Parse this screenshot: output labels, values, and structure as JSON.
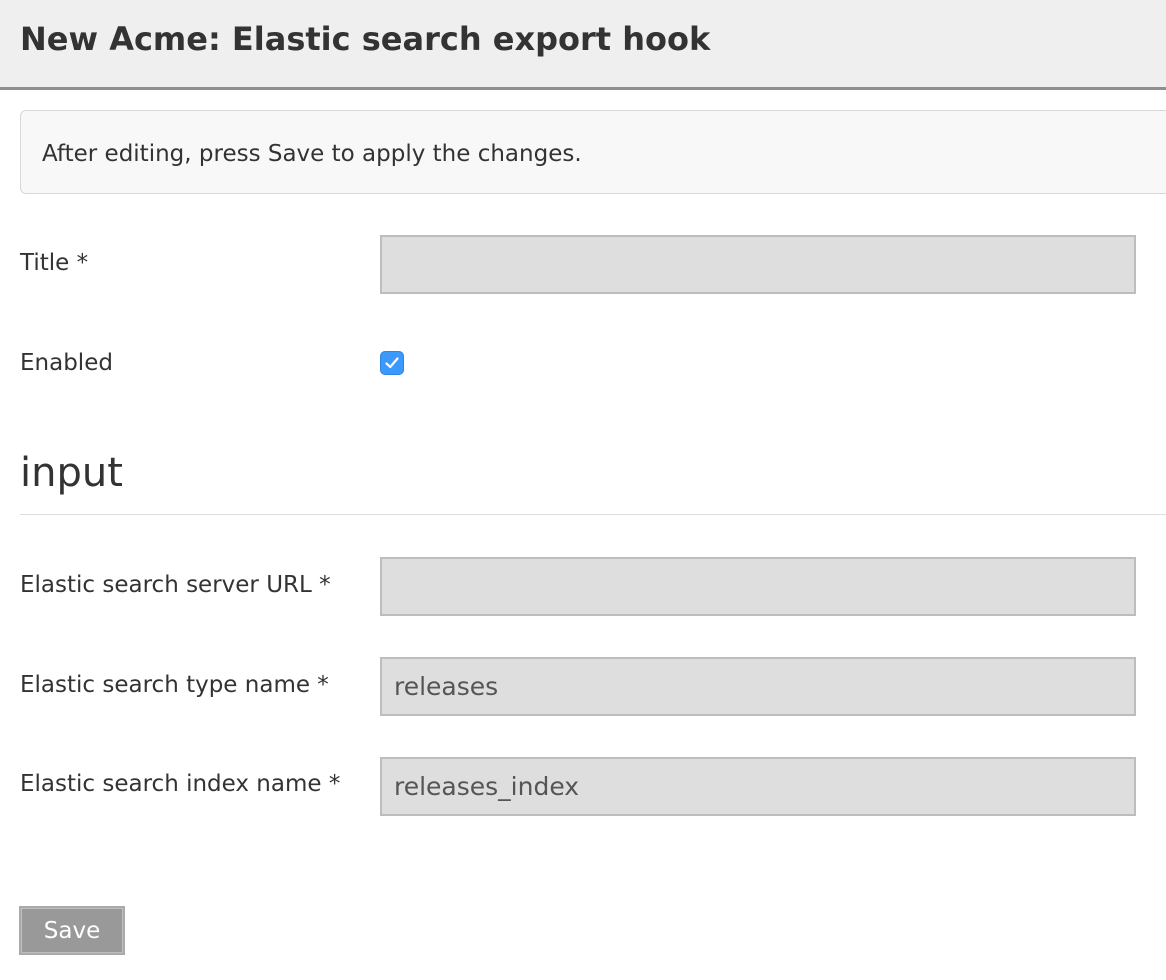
{
  "header": {
    "title": "New Acme: Elastic search export hook"
  },
  "notice": {
    "text": "After editing, press Save to apply the changes."
  },
  "form": {
    "title": {
      "label": "Title *",
      "value": ""
    },
    "enabled": {
      "label": "Enabled",
      "checked": true
    }
  },
  "section": {
    "title": "input"
  },
  "input": {
    "server_url": {
      "label": "Elastic search server URL *",
      "value": ""
    },
    "type_name": {
      "label": "Elastic search type name *",
      "value": "releases"
    },
    "index_name": {
      "label": "Elastic search index name *",
      "value": "releases_index"
    }
  },
  "actions": {
    "save_label": "Save"
  },
  "colors": {
    "checkbox_accent": "#3b99fc",
    "save_button": "#999999",
    "field_background": "#dedede",
    "header_background": "#efefef"
  }
}
